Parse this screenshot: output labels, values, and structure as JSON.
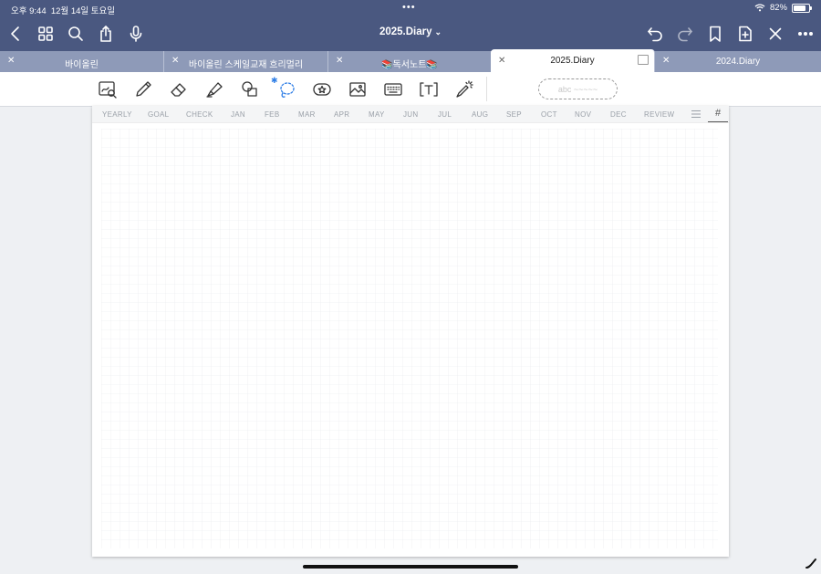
{
  "status_bar": {
    "time": "오후 9:44",
    "date": "12월 14일 토요일",
    "battery": "82%",
    "battery_level": 0.82
  },
  "navbar": {
    "title": "2025.Diary"
  },
  "tabs": [
    {
      "label": "바이올린",
      "active": false
    },
    {
      "label": "바이올린 스케일교재 흐리멀리",
      "active": false
    },
    {
      "label": "📚독서노트📚",
      "active": false
    },
    {
      "label": "2025.Diary",
      "active": true
    },
    {
      "label": "2024.Diary",
      "active": false
    }
  ],
  "toolbar": {
    "tools": [
      "zoom-window-icon",
      "pen-icon",
      "eraser-icon",
      "highlighter-icon",
      "shapes-icon",
      "lasso-icon",
      "sticker-icon",
      "image-icon",
      "keyboard-icon",
      "text-box-icon",
      "laser-pointer-icon"
    ],
    "pill_text": "abc ~~~~~",
    "accent": "#2f7ee6"
  },
  "page_nav": {
    "links": [
      "YEARLY",
      "GOAL",
      "CHECK",
      "JAN",
      "FEB",
      "MAR",
      "APR",
      "MAY",
      "JUN",
      "JUL",
      "AUG",
      "SEP",
      "OCT",
      "NOV",
      "DEC",
      "REVIEW"
    ]
  },
  "colors": {
    "topbar": "#4a5880",
    "tabbar": "#8e9ab8",
    "grid": "#e6e8eb"
  }
}
